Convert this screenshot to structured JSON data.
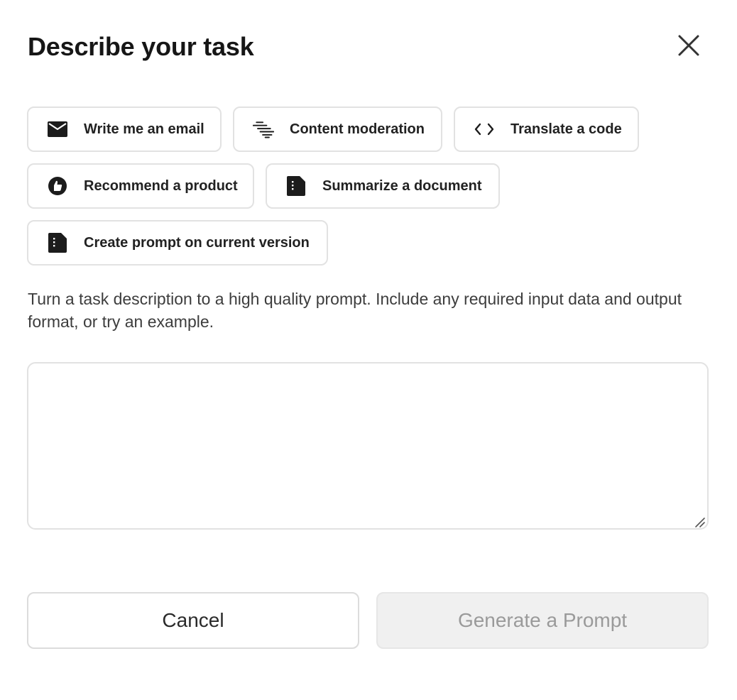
{
  "dialog": {
    "title": "Describe your task",
    "close_icon": "close-icon"
  },
  "chips": [
    [
      {
        "icon": "envelope-icon",
        "label": "Write me an email"
      },
      {
        "icon": "moderation-lines-icon",
        "label": "Content moderation"
      },
      {
        "icon": "code-brackets-icon",
        "label": "Translate a code"
      }
    ],
    [
      {
        "icon": "thumbs-up-icon",
        "label": "Recommend a product"
      },
      {
        "icon": "document-icon",
        "label": "Summarize a document"
      }
    ],
    [
      {
        "icon": "document-icon",
        "label": "Create prompt on current version"
      }
    ]
  ],
  "description": "Turn a task description to a high quality prompt. Include any required input data and output format, or try an example.",
  "task_input": {
    "value": "",
    "placeholder": ""
  },
  "buttons": {
    "cancel_label": "Cancel",
    "generate_label": "Generate a Prompt",
    "generate_disabled": true
  },
  "colors": {
    "border": "#e2e2e2",
    "disabled_bg": "#f0f0f0",
    "disabled_text": "#9a9a9a",
    "title_text": "#161616"
  }
}
